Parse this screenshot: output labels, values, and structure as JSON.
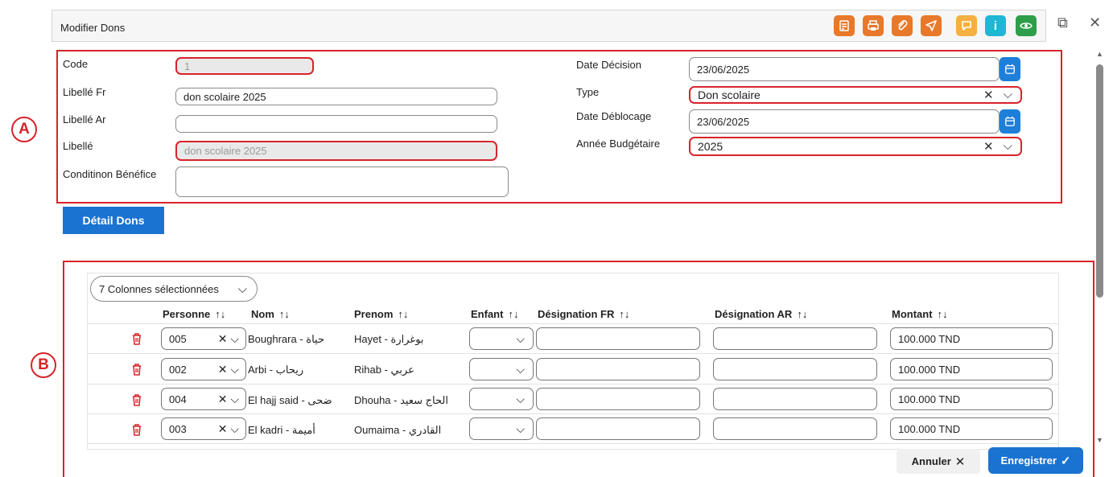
{
  "window": {
    "title": "Modifier Dons",
    "toolbar": [
      {
        "icon": "accounting-icon",
        "color": "#e8782a"
      },
      {
        "icon": "print-icon",
        "color": "#e8782a"
      },
      {
        "icon": "paperclip-icon",
        "color": "#e8782a"
      },
      {
        "icon": "send-icon",
        "color": "#e8782a"
      },
      {
        "icon": "chat-icon",
        "color": "#f5b041"
      },
      {
        "icon": "info-icon",
        "color": "#21b6d6"
      },
      {
        "icon": "eye-icon",
        "color": "#2e9e4a"
      }
    ],
    "restore_glyph": "⧉",
    "close_glyph": "✕"
  },
  "annotations": {
    "a": "A",
    "b": "B"
  },
  "form": {
    "code_label": "Code",
    "code_value": "1",
    "libelle_fr_label": "Libellé Fr",
    "libelle_fr_value": "don scolaire 2025",
    "libelle_ar_label": "Libellé Ar",
    "libelle_ar_value": "",
    "libelle_label": "Libellé",
    "libelle_value": "don scolaire 2025",
    "condition_label": "Conditinon Bénéfice",
    "condition_value": "",
    "date_decision_label": "Date Décision",
    "date_decision_value": "23/06/2025",
    "type_label": "Type",
    "type_value": "Don scolaire",
    "date_deblocage_label": "Date Déblocage",
    "date_deblocage_value": "23/06/2025",
    "annee_label": "Année Budgétaire",
    "annee_value": "2025"
  },
  "tab_label": "Détail Dons",
  "table": {
    "columns_selector": "7 Colonnes sélectionnées",
    "headers": [
      "Personne",
      "Nom",
      "Prenom",
      "Enfant",
      "Désignation FR",
      "Désignation AR",
      "Montant"
    ],
    "sort_glyph": "↑↓",
    "rows": [
      {
        "personne": "005",
        "nom": "Boughrara - حياة",
        "prenom": "Hayet - بوغرارة",
        "montant": "100.000 TND"
      },
      {
        "personne": "002",
        "nom": "Arbi - ريحاب",
        "prenom": "Rihab - عربي",
        "montant": "100.000 TND"
      },
      {
        "personne": "004",
        "nom": "El hajj said - ضحى",
        "prenom": "Dhouha - الحاج سعيد",
        "montant": "100.000 TND"
      },
      {
        "personne": "003",
        "nom": "El kadri - أميمة",
        "prenom": "Oumaima - القادري",
        "montant": "100.000 TND"
      }
    ]
  },
  "footer": {
    "cancel_label": "Annuler",
    "save_label": "Enregistrer"
  }
}
